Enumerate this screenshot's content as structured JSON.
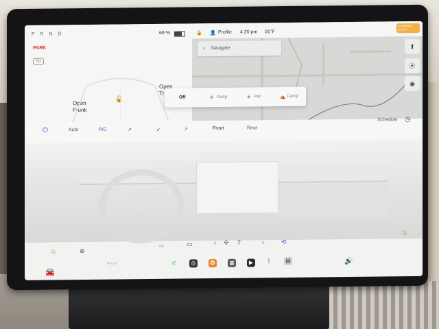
{
  "top_left": {
    "gears": "P R N D",
    "park": "PARK",
    "battery": "69 %",
    "frunk": {
      "line1": "Open",
      "line2": "Frunk"
    },
    "trunk": {
      "line1": "Open",
      "line2": "Tr"
    }
  },
  "status_bar": {
    "profile": "Profile",
    "time": "4:20 pm",
    "temp": "91°F",
    "badge": "PASSENGER AIRBAG"
  },
  "map": {
    "search_placeholder": "Navigate"
  },
  "climate_modes": {
    "off": "Off",
    "keep": "Keep",
    "pet": "Pet",
    "camp": "Camp"
  },
  "climate_bar": {
    "auto": "Auto",
    "ac": "A/C",
    "front": "Front",
    "rear": "Rear",
    "schedule": "Schedule"
  },
  "fan": {
    "speed": "7"
  },
  "driver_temp": {
    "label": "Manual",
    "value": "LO"
  },
  "colors": {
    "accent_blue": "#2a5fd8",
    "park_red": "#d9322c",
    "badge_orange": "#f1b14a"
  }
}
